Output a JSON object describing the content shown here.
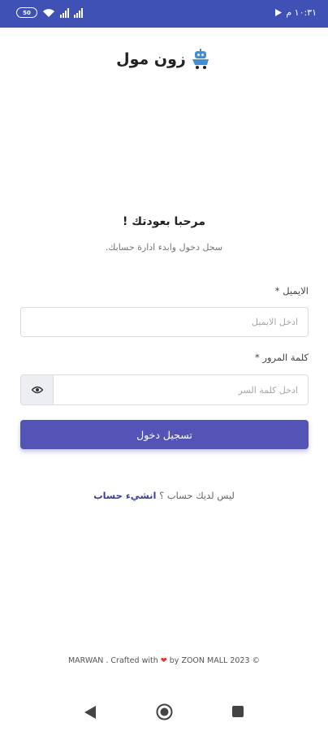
{
  "status_bar": {
    "time": "١٠:٣١ م",
    "battery": "50"
  },
  "app": {
    "logo_text": "زون مول"
  },
  "welcome": {
    "title": "مرحبا بعودتك !",
    "subtitle": "سجل دخول وابدء ادارة حسابك."
  },
  "form": {
    "email_label": "الايميل",
    "email_placeholder": "ادخل الايميل",
    "password_label": "كلمة المرور",
    "password_placeholder": "ادخل كلمة السر",
    "required_mark": "*",
    "submit_label": "تسجيل دخول"
  },
  "signup": {
    "prompt": "ليس لديك حساب ؟",
    "link_label": "انشيء حساب"
  },
  "footer": {
    "prefix": "MARWAN . Crafted with",
    "heart": "❤",
    "suffix": "by ZOON MALL 2023 ©"
  },
  "colors": {
    "status_bar": "#3f51b5",
    "primary_button": "#5354b5",
    "link": "#3f4196",
    "heart": "#e53935"
  }
}
